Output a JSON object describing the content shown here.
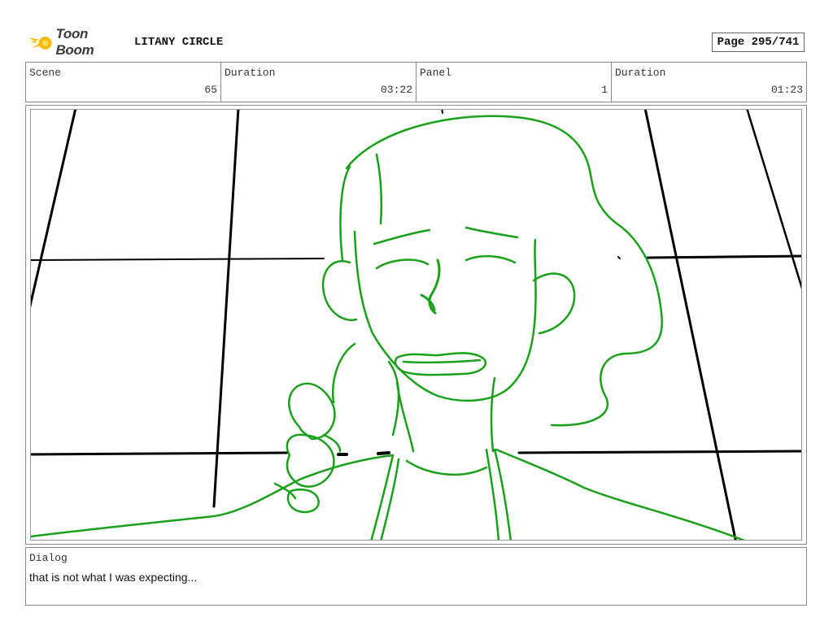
{
  "header": {
    "logo_text": "Toon Boom",
    "project_title": "LITANY CIRCLE",
    "page_label": "Page 295/741"
  },
  "info": [
    {
      "label": "Scene",
      "value": "65"
    },
    {
      "label": "Duration",
      "value": "03:22"
    },
    {
      "label": "Panel",
      "value": "1"
    },
    {
      "label": "Duration",
      "value": "01:23"
    }
  ],
  "panel": {
    "sketch_color": "#1aa01a",
    "line_color": "#000000"
  },
  "dialog": {
    "label": "Dialog",
    "text": "that is not what I was expecting..."
  },
  "colors": {
    "logo_accent": "#f6b800",
    "border": "#888888"
  }
}
